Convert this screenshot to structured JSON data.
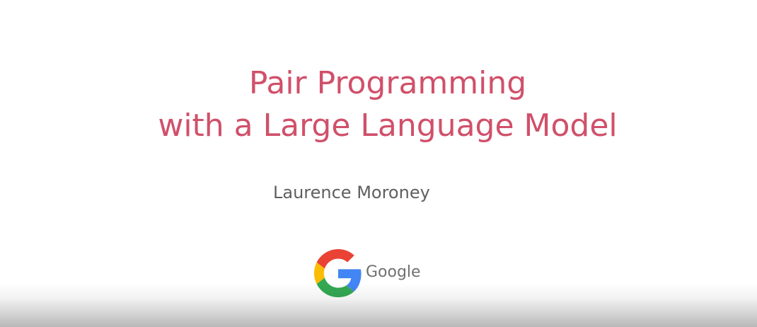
{
  "slide": {
    "title_line_1": "Pair Programming",
    "title_line_2": "with a Large Language Model",
    "presenter": "Laurence Moroney",
    "logo_text": "Google"
  },
  "colors": {
    "title": "#d0506a",
    "presenter": "#5f5f5f",
    "logo_text": "#707070",
    "google_blue": "#4285F4",
    "google_red": "#EA4335",
    "google_yellow": "#FBBC05",
    "google_green": "#34A853"
  },
  "icons": {
    "logo": "google-g-icon"
  }
}
